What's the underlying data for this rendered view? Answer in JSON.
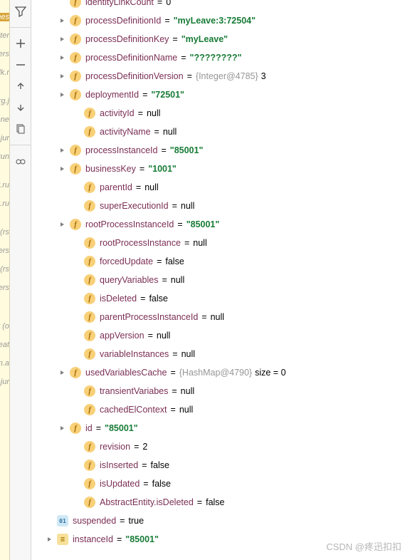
{
  "leftEdge": [
    "nes",
    "nter",
    "ers,",
    "dk.r",
    "",
    "rg.j",
    "nne",
    "g.jur",
    "run",
    "",
    "t.ru",
    "t.ru",
    "",
    "rs)",
    "ers,",
    "rs)",
    "ers)",
    "",
    "",
    "r (o",
    "eat",
    "m.a",
    "n.jur"
  ],
  "watermark": "CSDN @疼迅扣扣",
  "rows": [
    {
      "indent": 38,
      "arrow": false,
      "badge": "f",
      "name": "identityLinkCount",
      "vtype": "plain",
      "value": "0",
      "cut": true
    },
    {
      "indent": 38,
      "arrow": true,
      "badge": "f",
      "name": "processDefinitionId",
      "vtype": "str",
      "value": "\"myLeave:3:72504\""
    },
    {
      "indent": 38,
      "arrow": true,
      "badge": "f",
      "name": "processDefinitionKey",
      "vtype": "str",
      "value": "\"myLeave\""
    },
    {
      "indent": 38,
      "arrow": true,
      "badge": "f",
      "name": "processDefinitionName",
      "vtype": "str",
      "value": "\"????????\""
    },
    {
      "indent": 38,
      "arrow": true,
      "badge": "f",
      "name": "processDefinitionVersion",
      "vtype": "obj",
      "value": "{Integer@4785}",
      "tail": " 3"
    },
    {
      "indent": 38,
      "arrow": true,
      "badge": "f",
      "name": "deploymentId",
      "vtype": "str",
      "value": "\"72501\""
    },
    {
      "indent": 58,
      "arrow": false,
      "badge": "f",
      "name": "activityId",
      "vtype": "null",
      "value": "null"
    },
    {
      "indent": 58,
      "arrow": false,
      "badge": "f",
      "name": "activityName",
      "vtype": "null",
      "value": "null"
    },
    {
      "indent": 38,
      "arrow": true,
      "badge": "f",
      "name": "processInstanceId",
      "vtype": "str",
      "value": "\"85001\""
    },
    {
      "indent": 38,
      "arrow": true,
      "badge": "f",
      "name": "businessKey",
      "vtype": "str",
      "value": "\"1001\""
    },
    {
      "indent": 58,
      "arrow": false,
      "badge": "f",
      "name": "parentId",
      "vtype": "null",
      "value": "null"
    },
    {
      "indent": 58,
      "arrow": false,
      "badge": "f",
      "name": "superExecutionId",
      "vtype": "null",
      "value": "null"
    },
    {
      "indent": 38,
      "arrow": true,
      "badge": "f",
      "name": "rootProcessInstanceId",
      "vtype": "str",
      "value": "\"85001\""
    },
    {
      "indent": 58,
      "arrow": false,
      "badge": "f",
      "name": "rootProcessInstance",
      "vtype": "null",
      "value": "null"
    },
    {
      "indent": 58,
      "arrow": false,
      "badge": "f",
      "name": "forcedUpdate",
      "vtype": "plain",
      "value": "false"
    },
    {
      "indent": 58,
      "arrow": false,
      "badge": "f",
      "name": "queryVariables",
      "vtype": "null",
      "value": "null"
    },
    {
      "indent": 58,
      "arrow": false,
      "badge": "f",
      "name": "isDeleted",
      "vtype": "plain",
      "value": "false"
    },
    {
      "indent": 58,
      "arrow": false,
      "badge": "f",
      "name": "parentProcessInstanceId",
      "vtype": "null",
      "value": "null"
    },
    {
      "indent": 58,
      "arrow": false,
      "badge": "f",
      "name": "appVersion",
      "vtype": "null",
      "value": "null"
    },
    {
      "indent": 58,
      "arrow": false,
      "badge": "f",
      "name": "variableInstances",
      "vtype": "null",
      "value": "null"
    },
    {
      "indent": 38,
      "arrow": true,
      "badge": "f",
      "name": "usedVariablesCache",
      "vtype": "obj",
      "value": "{HashMap@4790}",
      "tail": "  size = 0"
    },
    {
      "indent": 58,
      "arrow": false,
      "badge": "f",
      "name": "transientVariabes",
      "vtype": "null",
      "value": "null"
    },
    {
      "indent": 58,
      "arrow": false,
      "badge": "f",
      "name": "cachedElContext",
      "vtype": "null",
      "value": "null"
    },
    {
      "indent": 38,
      "arrow": true,
      "badge": "f",
      "name": "id",
      "vtype": "str",
      "value": "\"85001\""
    },
    {
      "indent": 58,
      "arrow": false,
      "badge": "f",
      "name": "revision",
      "vtype": "plain",
      "value": "2"
    },
    {
      "indent": 58,
      "arrow": false,
      "badge": "f",
      "name": "isInserted",
      "vtype": "plain",
      "value": "false"
    },
    {
      "indent": 58,
      "arrow": false,
      "badge": "f",
      "name": "isUpdated",
      "vtype": "plain",
      "value": "false"
    },
    {
      "indent": 58,
      "arrow": false,
      "badge": "f",
      "name": "AbstractEntity.isDeleted",
      "vtype": "plain",
      "value": "false"
    },
    {
      "indent": 20,
      "arrow": false,
      "badge": "01",
      "name": "suspended",
      "vtype": "plain",
      "value": "true"
    },
    {
      "indent": 20,
      "arrow": true,
      "badge": "eq",
      "name": "instanceId",
      "vtype": "str",
      "value": "\"85001\""
    }
  ]
}
